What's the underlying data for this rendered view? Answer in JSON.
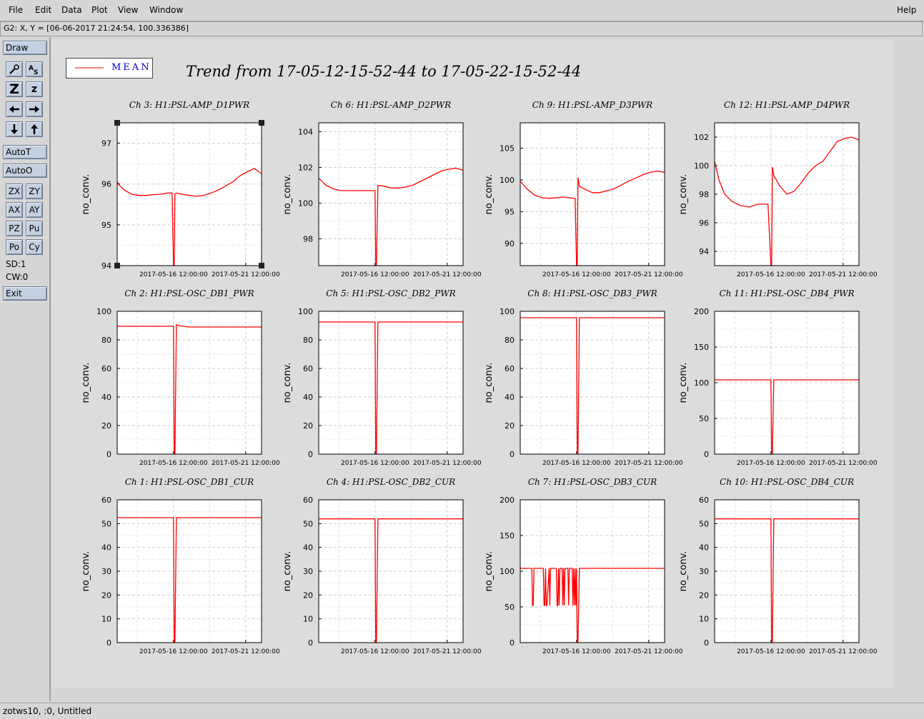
{
  "menu": {
    "file": "File",
    "edit": "Edit",
    "data": "Data",
    "plot": "Plot",
    "view": "View",
    "window": "Window",
    "help": "Help"
  },
  "coord_readout": "G2: X, Y = [06-06-2017 21:24:54, 100.336386]",
  "toolbar": {
    "draw": "Draw",
    "autot": "AutoT",
    "autoo": "AutoO",
    "zx": "ZX",
    "zy": "ZY",
    "ax": "AX",
    "ay": "AY",
    "pz": "PZ",
    "pu": "Pu",
    "po": "Po",
    "cy": "Cy",
    "zoom_big": "Z",
    "zoom_small": "z",
    "sd": "SD:1",
    "cw": "CW:0",
    "exit": "Exit"
  },
  "legend": {
    "label": "MEAN",
    "color": "#ff0000"
  },
  "title": "Trend from 17-05-12-15-52-44 to 17-05-22-15-52-44",
  "status": "zotws10, :0, Untitled",
  "colors": {
    "trace": "#ff0000",
    "label_blue": "#0000cc"
  },
  "chart_data": [
    {
      "type": "line",
      "title": "Ch 3: H1:PSL-AMP_D1PWR",
      "ylabel": "no_conv.",
      "xticks": [
        "2017-05-16 12:00:00",
        "2017-05-21 12:00:00"
      ],
      "ylim": [
        94,
        97.5
      ],
      "yticks": [
        94,
        95,
        96,
        97
      ],
      "x": [
        0,
        0.02,
        0.05,
        0.1,
        0.15,
        0.2,
        0.25,
        0.3,
        0.35,
        0.38,
        0.39,
        0.395,
        0.4,
        0.41,
        0.45,
        0.5,
        0.55,
        0.6,
        0.65,
        0.7,
        0.75,
        0.8,
        0.85,
        0.9,
        0.95,
        1
      ],
      "y": [
        96.05,
        95.95,
        95.85,
        95.75,
        95.72,
        95.72,
        95.74,
        95.75,
        95.78,
        95.78,
        94,
        94,
        95.75,
        95.78,
        95.75,
        95.72,
        95.7,
        95.72,
        95.78,
        95.85,
        95.95,
        96.05,
        96.2,
        96.3,
        96.38,
        96.25
      ]
    },
    {
      "type": "line",
      "title": "Ch 6: H1:PSL-AMP_D2PWR",
      "ylabel": "no_conv.",
      "xticks": [
        "2017-05-16 12:00:00",
        "2017-05-21 12:00:00"
      ],
      "ylim": [
        96.5,
        104.5
      ],
      "yticks": [
        98,
        100,
        102,
        104
      ],
      "x": [
        0,
        0.05,
        0.1,
        0.15,
        0.2,
        0.3,
        0.39,
        0.395,
        0.4,
        0.41,
        0.45,
        0.5,
        0.55,
        0.6,
        0.65,
        0.7,
        0.75,
        0.8,
        0.85,
        0.9,
        0.95,
        1
      ],
      "y": [
        101.4,
        101,
        100.8,
        100.7,
        100.7,
        100.7,
        100.7,
        96.5,
        96.5,
        101,
        100.95,
        100.85,
        100.85,
        100.9,
        101,
        101.2,
        101.4,
        101.6,
        101.8,
        101.9,
        101.95,
        101.85
      ]
    },
    {
      "type": "line",
      "title": "Ch 9: H1:PSL-AMP_D3PWR",
      "ylabel": "no_conv.",
      "xticks": [
        "2017-05-16 12:00:00",
        "2017-05-21 12:00:00"
      ],
      "ylim": [
        86.5,
        109
      ],
      "yticks": [
        90,
        95,
        100,
        105
      ],
      "x": [
        0,
        0.05,
        0.1,
        0.15,
        0.2,
        0.3,
        0.38,
        0.39,
        0.395,
        0.4,
        0.41,
        0.45,
        0.5,
        0.55,
        0.6,
        0.65,
        0.7,
        0.75,
        0.8,
        0.85,
        0.9,
        0.95,
        1
      ],
      "y": [
        99.8,
        98.5,
        97.6,
        97.2,
        97.1,
        97.3,
        97.1,
        86.5,
        86.5,
        100.4,
        99,
        98.5,
        98,
        98,
        98.3,
        98.6,
        99.2,
        99.8,
        100.3,
        100.8,
        101.2,
        101.4,
        101.2
      ]
    },
    {
      "type": "line",
      "title": "Ch 12: H1:PSL-AMP_D4PWR",
      "ylabel": "no_conv.",
      "xticks": [
        "2017-05-16 12:00:00",
        "2017-05-21 12:00:00"
      ],
      "ylim": [
        93,
        103
      ],
      "yticks": [
        94,
        96,
        98,
        100,
        102
      ],
      "x": [
        0,
        0.03,
        0.07,
        0.12,
        0.18,
        0.24,
        0.3,
        0.37,
        0.39,
        0.395,
        0.4,
        0.41,
        0.45,
        0.5,
        0.55,
        0.6,
        0.65,
        0.7,
        0.75,
        0.8,
        0.85,
        0.9,
        0.95,
        1
      ],
      "y": [
        100.3,
        99,
        98,
        97.5,
        97.2,
        97.1,
        97.3,
        97.3,
        93,
        93,
        99.9,
        99.3,
        98.6,
        98,
        98.2,
        98.8,
        99.5,
        100,
        100.3,
        101,
        101.7,
        101.9,
        102,
        101.8
      ]
    },
    {
      "type": "line",
      "title": "Ch 2: H1:PSL-OSC_DB1_PWR",
      "ylabel": "no_conv.",
      "xticks": [
        "2017-05-16 12:00:00",
        "2017-05-21 12:00:00"
      ],
      "ylim": [
        0,
        100
      ],
      "yticks": [
        0,
        20,
        40,
        60,
        80,
        100
      ],
      "x": [
        0,
        0.2,
        0.39,
        0.395,
        0.4,
        0.41,
        0.45,
        0.5,
        0.6,
        0.8,
        1
      ],
      "y": [
        89.5,
        89.5,
        89.5,
        0,
        0,
        90.5,
        89.5,
        89,
        89,
        89,
        89
      ]
    },
    {
      "type": "line",
      "title": "Ch 5: H1:PSL-OSC_DB2_PWR",
      "ylabel": "no_conv.",
      "xticks": [
        "2017-05-16 12:00:00",
        "2017-05-21 12:00:00"
      ],
      "ylim": [
        0,
        100
      ],
      "yticks": [
        0,
        20,
        40,
        60,
        80,
        100
      ],
      "x": [
        0,
        0.2,
        0.39,
        0.395,
        0.4,
        0.41,
        0.6,
        0.8,
        1
      ],
      "y": [
        92.5,
        92.5,
        92.5,
        0,
        0,
        92.5,
        92.5,
        92.5,
        92.5
      ]
    },
    {
      "type": "line",
      "title": "Ch 8: H1:PSL-OSC_DB3_PWR",
      "ylabel": "no_conv.",
      "xticks": [
        "2017-05-16 12:00:00",
        "2017-05-21 12:00:00"
      ],
      "ylim": [
        0,
        100
      ],
      "yticks": [
        0,
        20,
        40,
        60,
        80,
        100
      ],
      "x": [
        0,
        0.2,
        0.39,
        0.395,
        0.4,
        0.41,
        0.6,
        0.8,
        1
      ],
      "y": [
        95.5,
        95.5,
        95.5,
        0,
        0,
        95.5,
        95.5,
        95.5,
        95.5
      ]
    },
    {
      "type": "line",
      "title": "Ch 11: H1:PSL-OSC_DB4_PWR",
      "ylabel": "no_conv.",
      "xticks": [
        "2017-05-16 12:00:00",
        "2017-05-21 12:00:00"
      ],
      "ylim": [
        0,
        200
      ],
      "yticks": [
        0,
        50,
        100,
        150,
        200
      ],
      "x": [
        0,
        0.2,
        0.39,
        0.395,
        0.4,
        0.41,
        0.6,
        0.8,
        1
      ],
      "y": [
        104,
        104,
        104,
        0,
        0,
        104,
        104,
        104,
        104
      ]
    },
    {
      "type": "line",
      "title": "Ch 1: H1:PSL-OSC_DB1_CUR",
      "ylabel": "no_conv.",
      "xticks": [
        "2017-05-16 12:00:00",
        "2017-05-21 12:00:00"
      ],
      "ylim": [
        0,
        60
      ],
      "yticks": [
        0,
        10,
        20,
        30,
        40,
        50,
        60
      ],
      "x": [
        0,
        0.2,
        0.39,
        0.395,
        0.4,
        0.41,
        0.6,
        0.8,
        1
      ],
      "y": [
        52.5,
        52.5,
        52.5,
        0,
        0,
        52.5,
        52.5,
        52.5,
        52.5
      ]
    },
    {
      "type": "line",
      "title": "Ch 4: H1:PSL-OSC_DB2_CUR",
      "ylabel": "no_conv.",
      "xticks": [
        "2017-05-16 12:00:00",
        "2017-05-21 12:00:00"
      ],
      "ylim": [
        0,
        60
      ],
      "yticks": [
        0,
        10,
        20,
        30,
        40,
        50,
        60
      ],
      "x": [
        0,
        0.2,
        0.39,
        0.395,
        0.4,
        0.41,
        0.6,
        0.8,
        1
      ],
      "y": [
        52,
        52,
        52,
        0,
        0,
        52,
        52,
        52,
        52
      ]
    },
    {
      "type": "line",
      "title": "Ch 7: H1:PSL-OSC_DB3_CUR",
      "ylabel": "no_conv.",
      "xticks": [
        "2017-05-16 12:00:00",
        "2017-05-21 12:00:00"
      ],
      "ylim": [
        0,
        200
      ],
      "yticks": [
        0,
        50,
        100,
        150,
        200
      ],
      "x": [
        0,
        0.08,
        0.085,
        0.09,
        0.095,
        0.16,
        0.165,
        0.17,
        0.175,
        0.18,
        0.185,
        0.2,
        0.205,
        0.21,
        0.25,
        0.255,
        0.26,
        0.265,
        0.27,
        0.275,
        0.29,
        0.295,
        0.3,
        0.305,
        0.31,
        0.315,
        0.33,
        0.335,
        0.34,
        0.36,
        0.365,
        0.37,
        0.375,
        0.38,
        0.385,
        0.39,
        0.395,
        0.4,
        0.405,
        0.41,
        0.6,
        0.8,
        1
      ],
      "y": [
        104,
        104,
        52,
        52,
        104,
        104,
        52,
        52,
        104,
        52,
        52,
        104,
        52,
        104,
        104,
        52,
        52,
        104,
        52,
        104,
        104,
        52,
        104,
        52,
        104,
        104,
        104,
        52,
        104,
        104,
        52,
        104,
        52,
        104,
        52,
        104,
        0,
        0,
        52,
        104,
        104,
        104,
        104
      ]
    },
    {
      "type": "line",
      "title": "Ch 10: H1:PSL-OSC_DB4_CUR",
      "ylabel": "no_conv.",
      "xticks": [
        "2017-05-16 12:00:00",
        "2017-05-21 12:00:00"
      ],
      "ylim": [
        0,
        60
      ],
      "yticks": [
        0,
        10,
        20,
        30,
        40,
        50,
        60
      ],
      "x": [
        0,
        0.2,
        0.39,
        0.395,
        0.4,
        0.41,
        0.6,
        0.8,
        1
      ],
      "y": [
        52,
        52,
        52,
        0,
        0,
        52,
        52,
        52,
        52
      ]
    }
  ]
}
